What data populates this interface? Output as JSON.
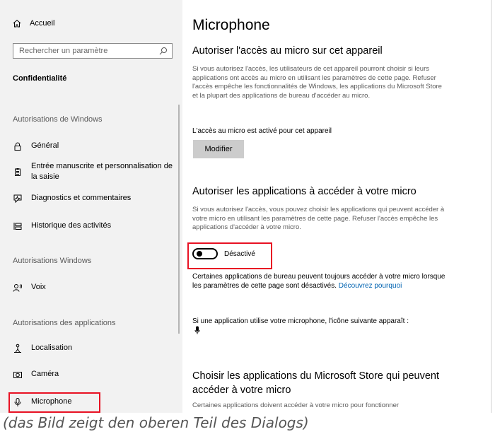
{
  "sidebar": {
    "home_label": "Accueil",
    "search_placeholder": "Rechercher un paramètre",
    "section_title": "Confidentialité",
    "groups": {
      "windows": "Autorisations de Windows",
      "windows2": "Autorisations Windows",
      "apps": "Autorisations des applications"
    },
    "items": [
      {
        "label": "Général",
        "icon": "lock-icon"
      },
      {
        "label": "Entrée manuscrite et personnalisation de la saisie",
        "icon": "clipboard-icon"
      },
      {
        "label": "Diagnostics et commentaires",
        "icon": "diagnostics-icon"
      },
      {
        "label": "Historique des activités",
        "icon": "activity-history-icon"
      },
      {
        "label": "Voix",
        "icon": "voice-icon"
      },
      {
        "label": "Localisation",
        "icon": "location-icon"
      },
      {
        "label": "Caméra",
        "icon": "camera-icon"
      },
      {
        "label": "Microphone",
        "icon": "microphone-icon"
      }
    ]
  },
  "main": {
    "title": "Microphone",
    "section1": {
      "heading": "Autoriser l'accès au micro sur cet appareil",
      "description": "Si vous autorisez l'accès, les utilisateurs de cet appareil pourront choisir si leurs applications ont accès au micro en utilisant les paramètres de cette page. Refuser l'accès empêche les fonctionnalités de Windows, les applications du Microsoft Store et la plupart des applications de bureau d'accéder au micro.",
      "status": "L'accès au micro est activé pour cet appareil",
      "button_label": "Modifier"
    },
    "section2": {
      "heading": "Autoriser les applications à accéder à votre micro",
      "description": "Si vous autorisez l'accès, vous pouvez choisir les applications qui peuvent accéder à votre micro en utilisant les paramètres de cette page. Refuser l'accès empêche les applications d'accéder à votre micro.",
      "toggle_label": "Désactivé",
      "toggle_state": "off",
      "note": "Certaines applications de bureau peuvent toujours accéder à votre micro lorsque les paramètres de cette page sont désactivés.",
      "note_link": "Découvrez pourquoi",
      "icon_note": "Si une application utilise votre microphone, l'icône suivante apparaît :"
    },
    "section3": {
      "heading": "Choisir les applications du Microsoft Store qui peuvent accéder à votre micro",
      "description": "Certaines applications doivent accéder à votre micro pour fonctionner"
    }
  },
  "caption": "(das Bild zeigt den oberen Teil des Dialogs)",
  "colors": {
    "highlight": "#e81123",
    "link": "#0063b1",
    "sidebar_bg": "#f2f2f2"
  }
}
